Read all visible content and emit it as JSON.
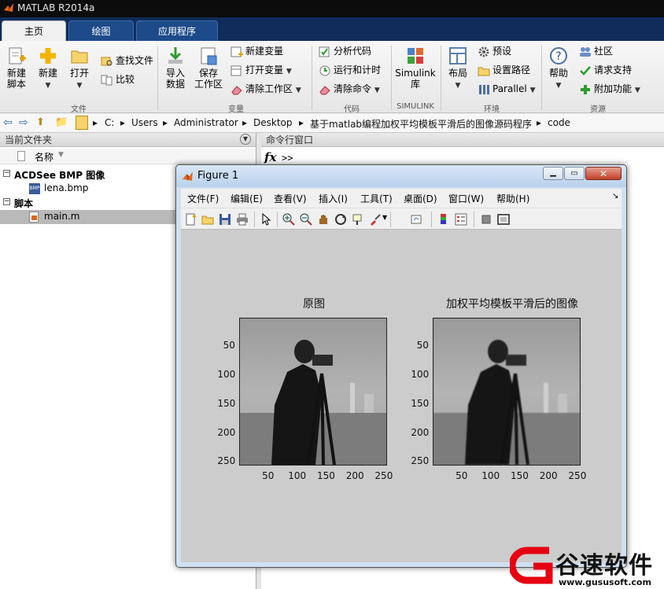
{
  "app": {
    "title": "MATLAB R2014a"
  },
  "tabs": [
    {
      "label": "主页",
      "active": true
    },
    {
      "label": "绘图",
      "active": false
    },
    {
      "label": "应用程序",
      "active": false
    }
  ],
  "ribbon": {
    "file": {
      "new_script": "新建\n脚本",
      "new_script_l1": "新建",
      "new_script_l2": "脚本",
      "new": "新建",
      "open": "打开",
      "find_files": "查找文件",
      "compare": "比较",
      "group": "文件"
    },
    "variable": {
      "import_l1": "导入",
      "import_l2": "数据",
      "save_l1": "保存",
      "save_l2": "工作区",
      "new_var": "新建变量",
      "open_var": "打开变量",
      "clear_ws": "清除工作区",
      "group": "变量"
    },
    "code": {
      "analyze": "分析代码",
      "run_time": "运行和计时",
      "clear_cmd": "清除命令",
      "group": "代码"
    },
    "simulink": {
      "l1": "Simulink",
      "l2": "库",
      "group": "SIMULINK"
    },
    "env": {
      "layout": "布局",
      "prefs": "预设",
      "set_path": "设置路径",
      "parallel": "Parallel",
      "group": "环境"
    },
    "resources": {
      "help": "帮助",
      "community": "社区",
      "support": "请求支持",
      "addons": "附加功能",
      "group": "资源"
    }
  },
  "address": {
    "segments": [
      "C:",
      "Users",
      "Administrator",
      "Desktop",
      "基于matlab编程加权平均模板平滑后的图像源码程序",
      "code"
    ]
  },
  "left_pane": {
    "title": "当前文件夹",
    "col_name": "名称",
    "groups": [
      {
        "label": "ACDSee BMP 图像",
        "items": [
          "lena.bmp"
        ]
      },
      {
        "label": "脚本",
        "items": [
          "main.m"
        ]
      }
    ]
  },
  "cmd_pane": {
    "title": "命令行窗口",
    "prompt": ">>",
    "fx": "fx"
  },
  "figure": {
    "title": "Figure 1",
    "menus": [
      "文件(F)",
      "编辑(E)",
      "查看(V)",
      "插入(I)",
      "工具(T)",
      "桌面(D)",
      "窗口(W)",
      "帮助(H)"
    ],
    "axes": [
      {
        "title": "原图",
        "xticks": [
          "50",
          "100",
          "150",
          "200",
          "250"
        ],
        "yticks": [
          "50",
          "100",
          "150",
          "200",
          "250"
        ]
      },
      {
        "title": "加权平均模板平滑后的图像",
        "xticks": [
          "50",
          "100",
          "150",
          "200",
          "250"
        ],
        "yticks": [
          "50",
          "100",
          "150",
          "200",
          "250"
        ]
      }
    ]
  },
  "watermark": {
    "brand": "谷速软件",
    "url": "www.gususoft.com"
  },
  "colors": {
    "tab_bg": "#0f2c5b",
    "accent": "#1d4b8a",
    "figure_bg": "#cccccc",
    "watermark_red": "#e60012"
  }
}
